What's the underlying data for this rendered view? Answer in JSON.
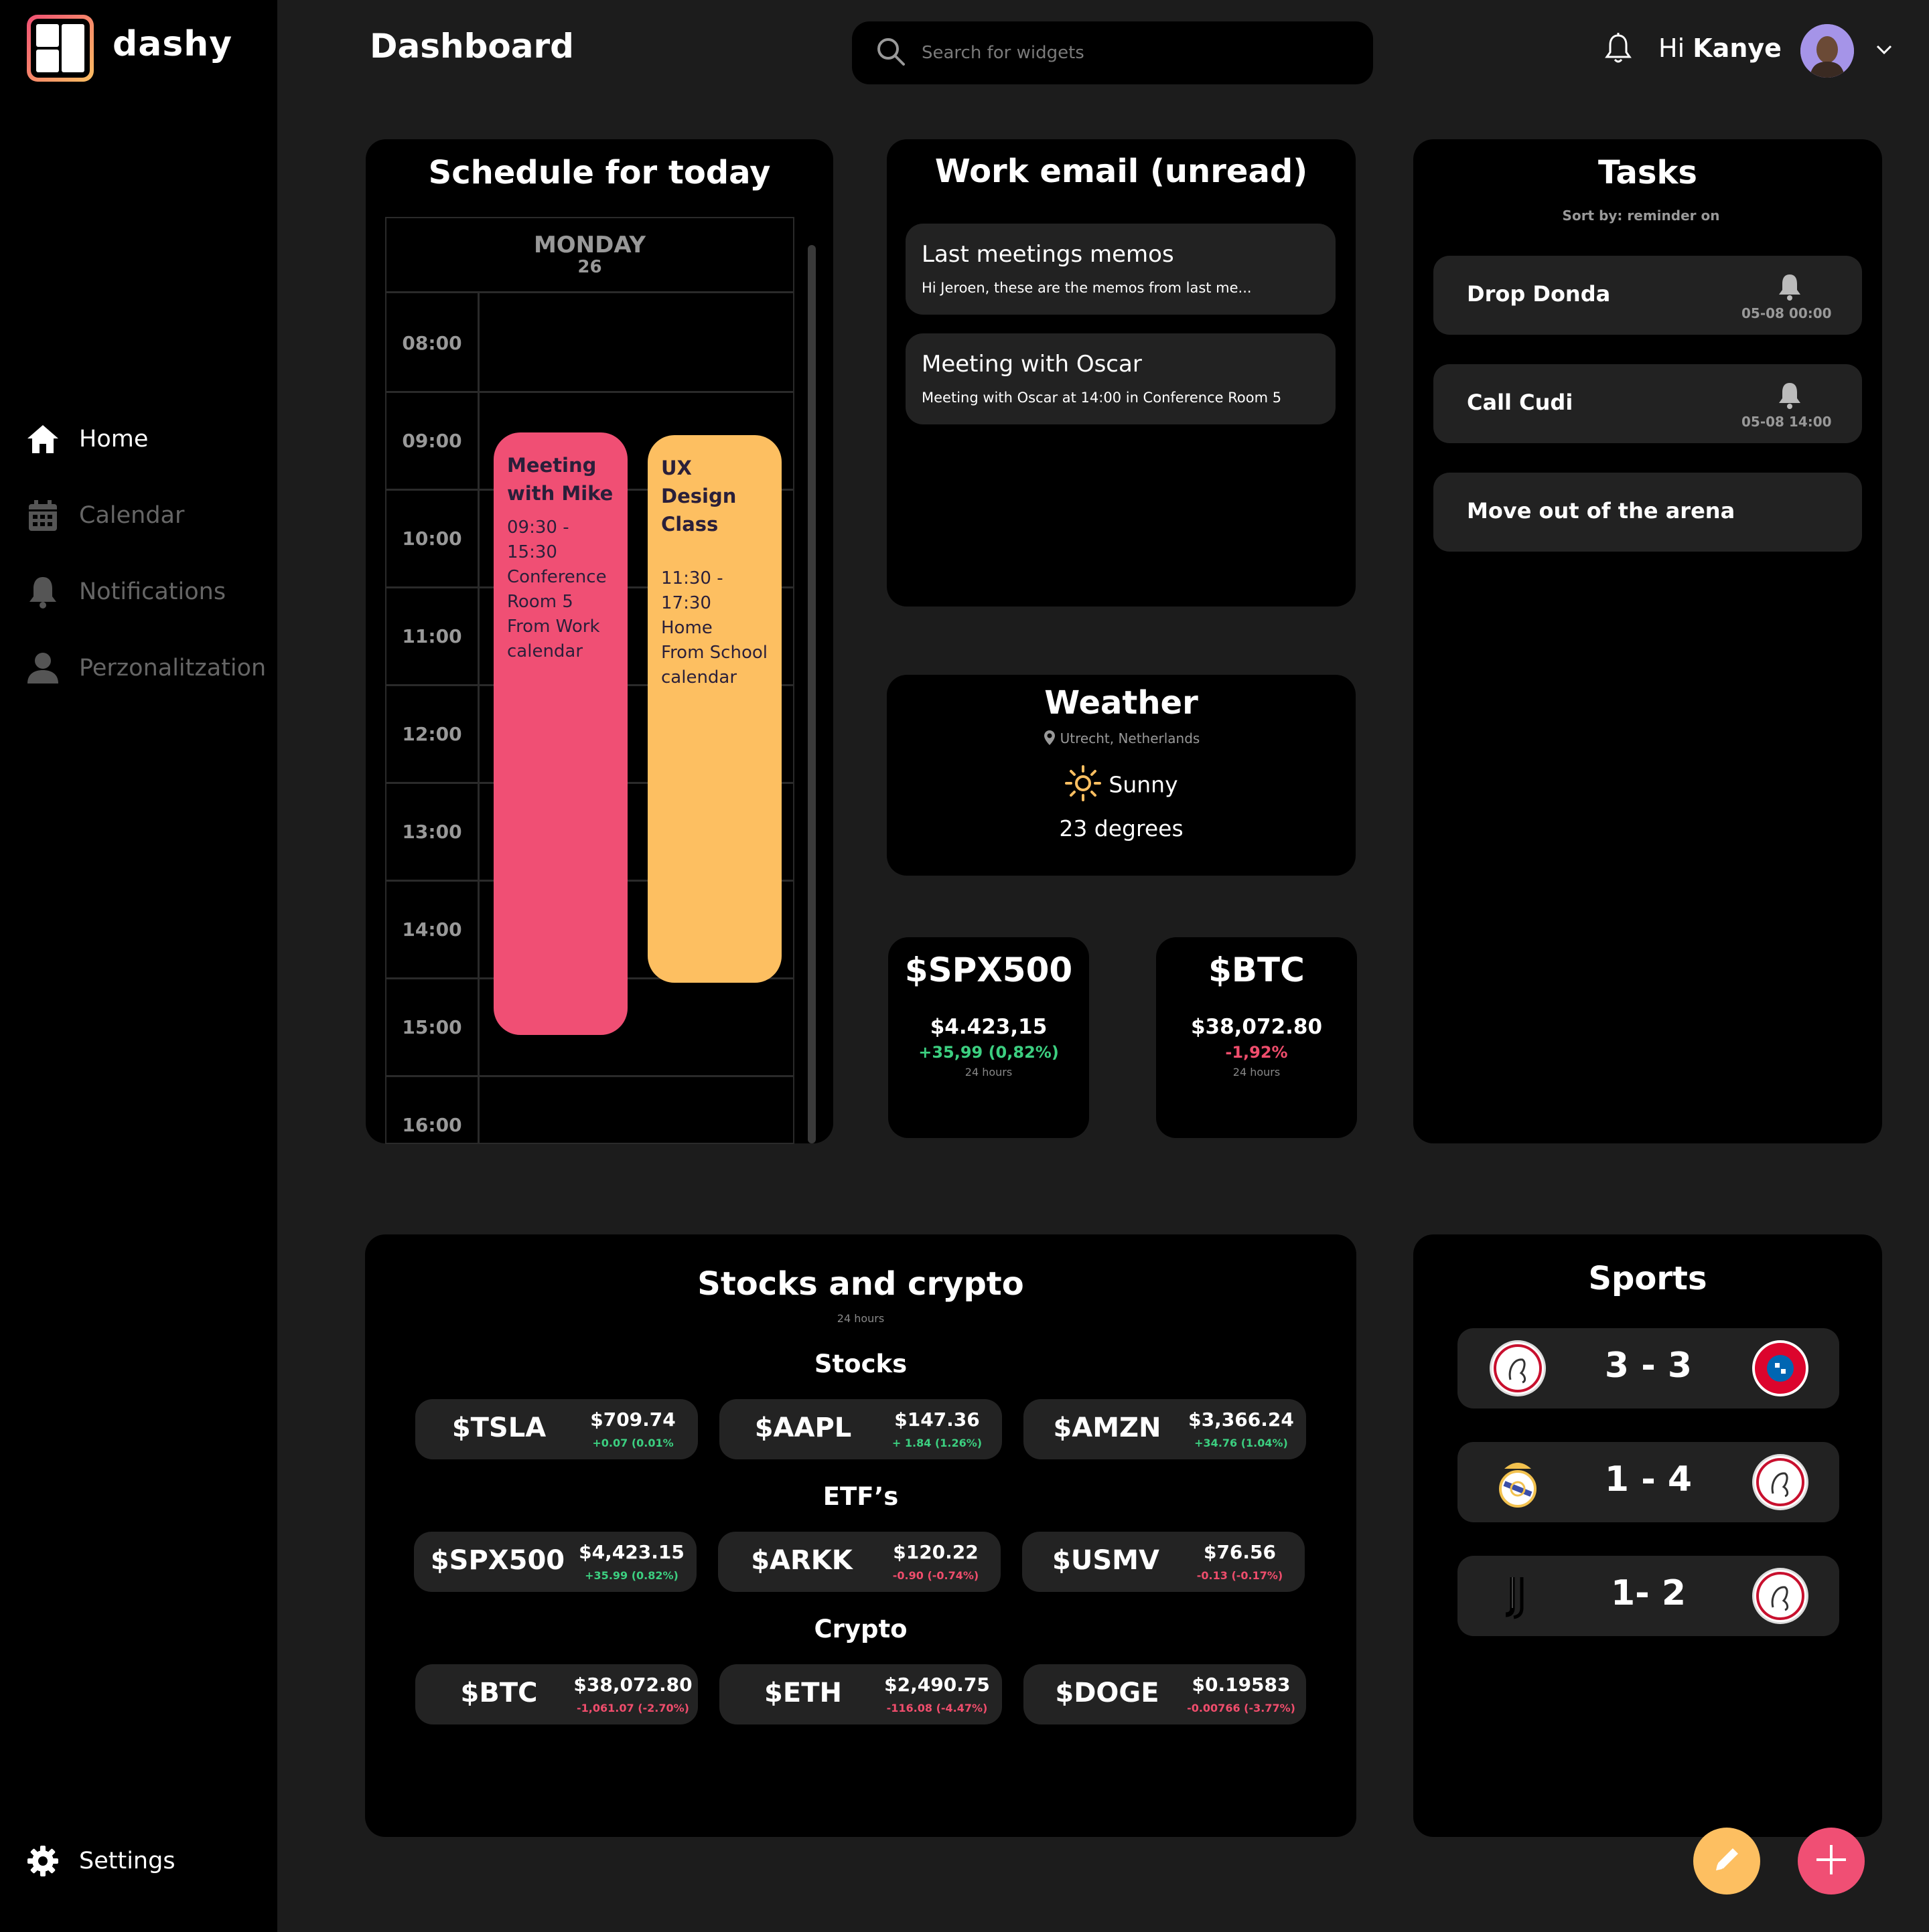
{
  "app": {
    "name": "dashy"
  },
  "sidebar": {
    "items": [
      {
        "label": "Home",
        "icon": "home-icon"
      },
      {
        "label": "Calendar",
        "icon": "calendar-icon"
      },
      {
        "label": "Notifications",
        "icon": "bell-icon"
      },
      {
        "label": "Perzonalitzation",
        "icon": "user-icon"
      }
    ],
    "settings_label": "Settings"
  },
  "header": {
    "title": "Dashboard",
    "search_placeholder": "Search for widgets",
    "greeting": "Hi",
    "username": "Kanye"
  },
  "schedule": {
    "title": "Schedule for today",
    "day": "MONDAY",
    "date": "26",
    "times": [
      "08:00",
      "09:00",
      "10:00",
      "11:00",
      "12:00",
      "13:00",
      "14:00",
      "15:00",
      "16:00"
    ],
    "events": [
      {
        "title": "Meeting with Mike",
        "time": "09:30 - 15:30",
        "location": "Conference Room 5",
        "source": "From Work calendar",
        "color": "#f04f74"
      },
      {
        "title": "UX Design Class",
        "time": "11:30 - 17:30",
        "location": "Home",
        "source": "From School calendar",
        "color": "#fdbf61"
      }
    ]
  },
  "email": {
    "title": "Work email (unread)",
    "items": [
      {
        "subject": "Last meetings memos",
        "preview": "Hi Jeroen, these are the memos from last me..."
      },
      {
        "subject": "Meeting with Oscar",
        "preview": "Meeting with Oscar at 14:00 in Conference Room 5"
      }
    ]
  },
  "tasks": {
    "title": "Tasks",
    "sort_label": "Sort by: reminder on",
    "items": [
      {
        "name": "Drop Donda",
        "reminder": "05-08 00:00"
      },
      {
        "name": "Call Cudi",
        "reminder": "05-08 14:00"
      },
      {
        "name": "Move out of the arena",
        "reminder": ""
      }
    ]
  },
  "weather": {
    "title": "Weather",
    "location": "Utrecht, Netherlands",
    "condition": "Sunny",
    "temperature": "23 degrees"
  },
  "mini_tickers": [
    {
      "symbol": "$SPX500",
      "price": "$4.423,15",
      "change": "+35,99 (0,82%)",
      "period": "24 hours",
      "direction": "up"
    },
    {
      "symbol": "$BTC",
      "price": "$38,072.80",
      "change": "-1,92%",
      "period": "24 hours",
      "direction": "down"
    }
  ],
  "stocks": {
    "title": "Stocks and crypto",
    "period": "24 hours",
    "sections": [
      {
        "heading": "Stocks",
        "items": [
          {
            "symbol": "$TSLA",
            "price": "$709.74",
            "change": "+0.07 (0.01%",
            "direction": "up"
          },
          {
            "symbol": "$AAPL",
            "price": "$147.36",
            "change": "+ 1.84 (1.26%)",
            "direction": "up"
          },
          {
            "symbol": "$AMZN",
            "price": "$3,366.24",
            "change": "+34.76 (1.04%)",
            "direction": "up"
          }
        ]
      },
      {
        "heading": "ETF’s",
        "items": [
          {
            "symbol": "$SPX500",
            "price": "$4,423.15",
            "change": "+35.99 (0.82%)",
            "direction": "up"
          },
          {
            "symbol": "$ARKK",
            "price": "$120.22",
            "change": "-0.90 (-0.74%)",
            "direction": "down"
          },
          {
            "symbol": "$USMV",
            "price": "$76.56",
            "change": "-0.13 (-0.17%)",
            "direction": "down"
          }
        ]
      },
      {
        "heading": "Crypto",
        "items": [
          {
            "symbol": "$BTC",
            "price": "$38,072.80",
            "change": "-1,061.07 (-2.70%)",
            "direction": "down"
          },
          {
            "symbol": "$ETH",
            "price": "$2,490.75",
            "change": "-116.08 (-4.47%)",
            "direction": "down"
          },
          {
            "symbol": "$DOGE",
            "price": "$0.19583",
            "change": "-0.00766 (-3.77%)",
            "direction": "down"
          }
        ]
      }
    ]
  },
  "sports": {
    "title": "Sports",
    "matches": [
      {
        "home": "ajax-crest",
        "score": "3 - 3",
        "away": "bayern-crest"
      },
      {
        "home": "real-madrid-crest",
        "score": "1 - 4",
        "away": "ajax-crest"
      },
      {
        "home": "juventus-crest",
        "score": "1- 2",
        "away": "ajax-crest"
      }
    ]
  },
  "colors": {
    "accent_pink": "#f04f74",
    "accent_yellow": "#fdbf61",
    "positive": "#3ccf80",
    "negative": "#ef4d6c",
    "card": "#000000",
    "background": "#1c1c1c"
  }
}
